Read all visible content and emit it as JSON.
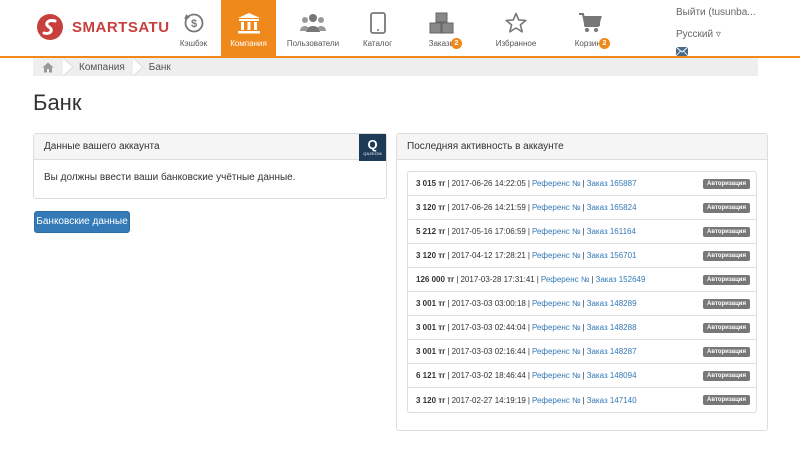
{
  "header": {
    "logo_text": "SMARTSATU",
    "nav": [
      {
        "label": "Кэшбэк",
        "icon": "cashback-icon"
      },
      {
        "label": "Компания",
        "icon": "bank-building-icon",
        "active": true
      },
      {
        "label": "Пользователи",
        "icon": "users-icon"
      },
      {
        "label": "Каталог",
        "icon": "tablet-icon"
      },
      {
        "label": "Заказы",
        "icon": "boxes-icon",
        "badge": "2"
      },
      {
        "label": "Избранное",
        "icon": "star-icon"
      },
      {
        "label": "Корзина",
        "icon": "cart-icon",
        "badge": "2"
      }
    ],
    "logout": "Выйти (tusunba...",
    "language": "Русский ▿",
    "accent_color": "#f0891b"
  },
  "breadcrumb": [
    "Компания",
    "Банк"
  ],
  "page_title": "Банк",
  "account_panel": {
    "title": "Данные вашего аккаунта",
    "message": "Вы должны ввести ваши банковские учётные данные.",
    "bank_logo_letter": "Q",
    "bank_logo_text": "QAZKOM"
  },
  "bank_button": "Банковские данные",
  "activity_panel": {
    "title": "Последняя активность в аккаунте",
    "rows": [
      {
        "amount": "3 015 тг",
        "datetime": "2017-06-26 14:22:05",
        "ref": "Референс №",
        "order": "Заказ 165887",
        "tag": "Авторизация"
      },
      {
        "amount": "3 120 тг",
        "datetime": "2017-06-26 14:21:59",
        "ref": "Референс №",
        "order": "Заказ 165824",
        "tag": "Авторизация"
      },
      {
        "amount": "5 212 тг",
        "datetime": "2017-05-16 17:06:59",
        "ref": "Референс №",
        "order": "Заказ 161164",
        "tag": "Авторизация"
      },
      {
        "amount": "3 120 тг",
        "datetime": "2017-04-12 17:28:21",
        "ref": "Референс №",
        "order": "Заказ 156701",
        "tag": "Авторизация"
      },
      {
        "amount": "126 000 тг",
        "datetime": "2017-03-28 17:31:41",
        "ref": "Референс №",
        "order": "Заказ 152649",
        "tag": "Авторизация"
      },
      {
        "amount": "3 001 тг",
        "datetime": "2017-03-03 03:00:18",
        "ref": "Референс №",
        "order": "Заказ 148289",
        "tag": "Авторизация"
      },
      {
        "amount": "3 001 тг",
        "datetime": "2017-03-03 02:44:04",
        "ref": "Референс №",
        "order": "Заказ 148288",
        "tag": "Авторизация"
      },
      {
        "amount": "3 001 тг",
        "datetime": "2017-03-03 02:16:44",
        "ref": "Референс №",
        "order": "Заказ 148287",
        "tag": "Авторизация"
      },
      {
        "amount": "6 121 тг",
        "datetime": "2017-03-02 18:46:44",
        "ref": "Референс №",
        "order": "Заказ 148094",
        "tag": "Авторизация"
      },
      {
        "amount": "3 120 тг",
        "datetime": "2017-02-27 14:19:19",
        "ref": "Референс №",
        "order": "Заказ 147140",
        "tag": "Авторизация"
      }
    ]
  }
}
